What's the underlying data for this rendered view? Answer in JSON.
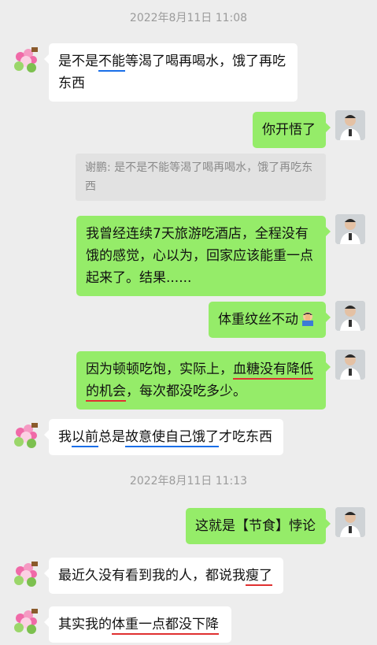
{
  "chat": {
    "timestamp_1": "2022年8月11日 11:08",
    "timestamp_2": "2022年8月11日 11:13",
    "messages": [
      {
        "from": "friend",
        "parts": [
          "是不是",
          "不能",
          "等渴了喝再喝水，饿了再吃东西"
        ]
      },
      {
        "from": "me",
        "text": "你开悟了"
      },
      {
        "from": "quote",
        "text": "谢鹏: 是不是不能等渴了喝再喝水，饿了再吃东西"
      },
      {
        "from": "me",
        "text": "我曾经连续7天旅游吃酒店，全程没有饿的感觉，心以为，回家应该能重一点起来了。结果......"
      },
      {
        "from": "me",
        "text": "体重纹丝不动"
      },
      {
        "from": "me",
        "parts": [
          "因为顿顿吃饱，实际上，",
          "血糖没有降低",
          "的机会",
          "，每次都没吃多少。"
        ]
      },
      {
        "from": "friend",
        "parts": [
          "我",
          "以前",
          "总是",
          "故意使自己饿了",
          "才吃东西"
        ]
      },
      {
        "from": "me",
        "text": "这就是【节食】悖论"
      },
      {
        "from": "friend",
        "parts": [
          "最近久没有看到我的人，都说我",
          "瘦了"
        ]
      },
      {
        "from": "friend",
        "parts": [
          "其实我的",
          "体重一点都没下降"
        ]
      }
    ]
  },
  "colors": {
    "background": "#ededed",
    "bubble_out": "#95ec69",
    "bubble_in": "#ffffff",
    "underline_blue": "#1a6fe8",
    "underline_red": "#e03030"
  },
  "icons": {
    "friend_avatar": "flower-cartoon-avatar",
    "me_avatar": "man-portrait-avatar",
    "emoji": "facepalm-emoji"
  }
}
